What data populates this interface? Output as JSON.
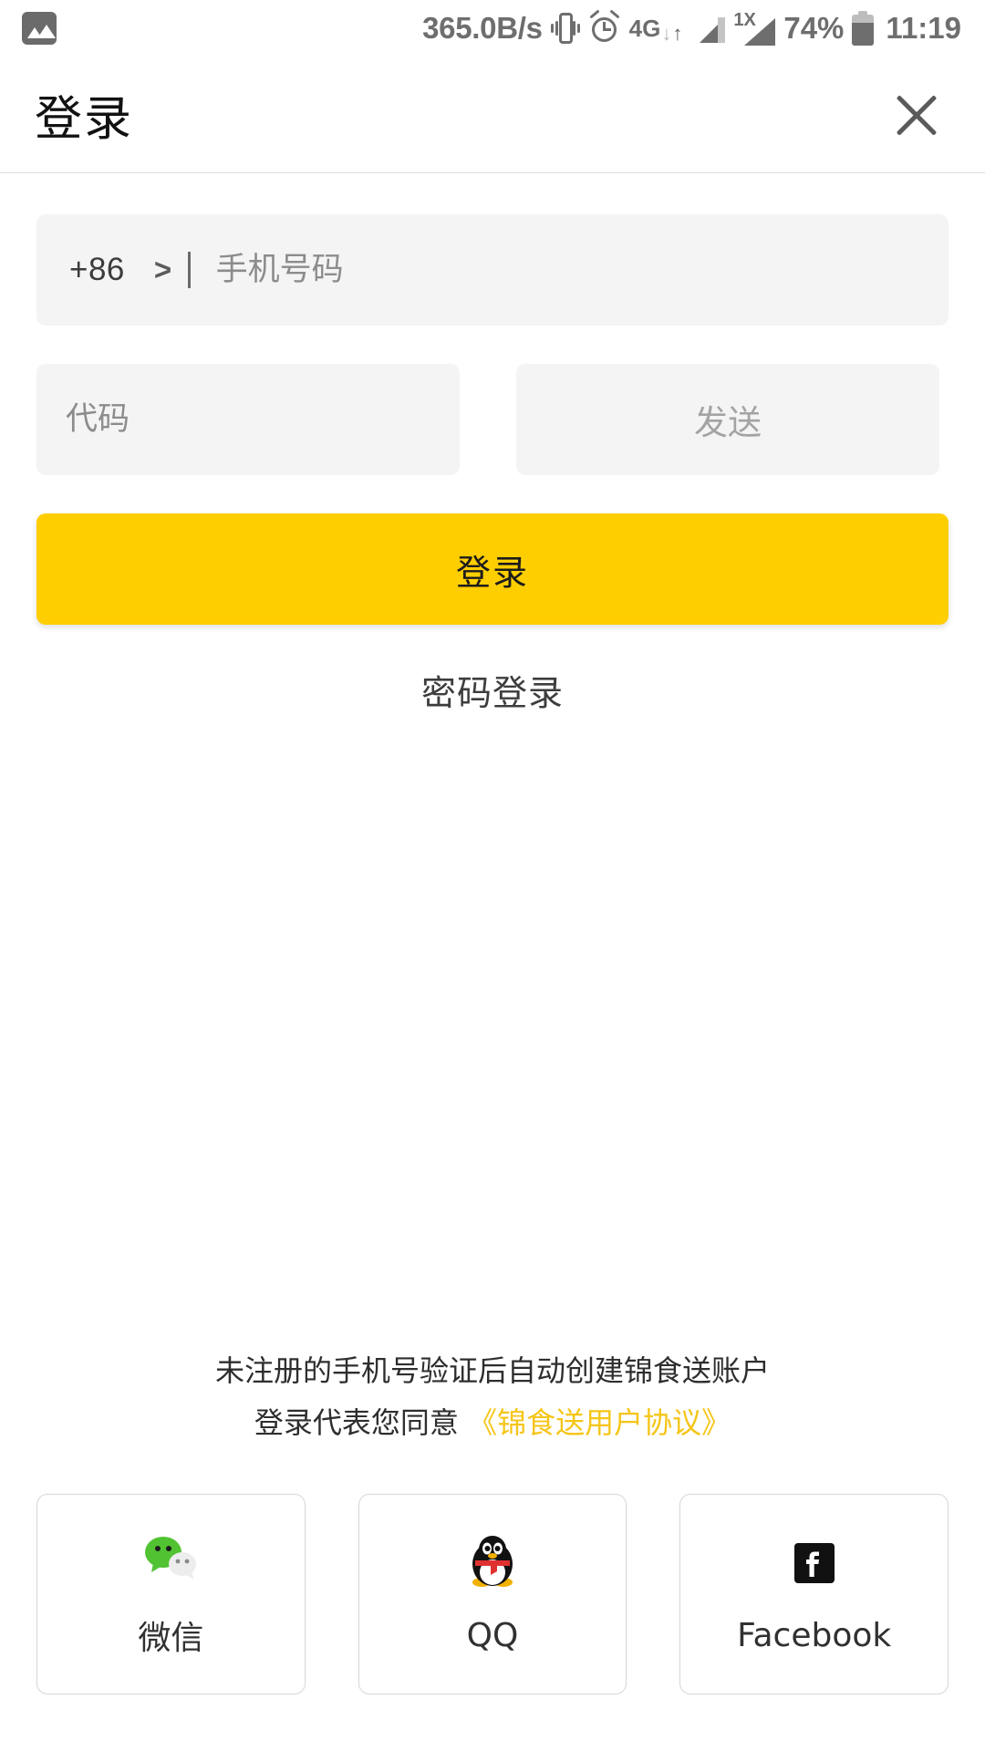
{
  "status_bar": {
    "notification_icon": "gallery-icon",
    "network_speed": "365.0B/s",
    "vibrate_icon": "vibrate-icon",
    "alarm_icon": "alarm-clock-icon",
    "data_network": "4G",
    "data_down_arrow": "↓",
    "data_up_arrow": "↑",
    "signal_icon": "signal-bars-icon",
    "signal2_label": "1X",
    "battery_percent": "74%",
    "battery_icon": "battery-icon",
    "time": "11:19"
  },
  "app_bar": {
    "title": "登录",
    "close_label": "×"
  },
  "form": {
    "country_code": "+86",
    "country_chevron": ">",
    "phone_placeholder": "手机号码",
    "phone_value": "",
    "code_placeholder": "代码",
    "code_value": "",
    "send_label": "发送",
    "login_label": "登录",
    "password_login_label": "密码登录"
  },
  "footer": {
    "agreement_line1": "未注册的手机号验证后自动创建锦食送账户",
    "agreement_line2_prefix": "登录代表您同意",
    "agreement_link": "《锦食送用户协议》",
    "social": [
      {
        "label": "微信",
        "icon": "wechat-icon"
      },
      {
        "label": "QQ",
        "icon": "qq-penguin-icon"
      },
      {
        "label": "Facebook",
        "icon": "facebook-icon"
      }
    ]
  },
  "colors": {
    "accent_yellow": "#FFCE00",
    "link_yellow": "#F5C518",
    "field_bg": "#F4F4F4",
    "status_grey": "#6E6E6E"
  }
}
